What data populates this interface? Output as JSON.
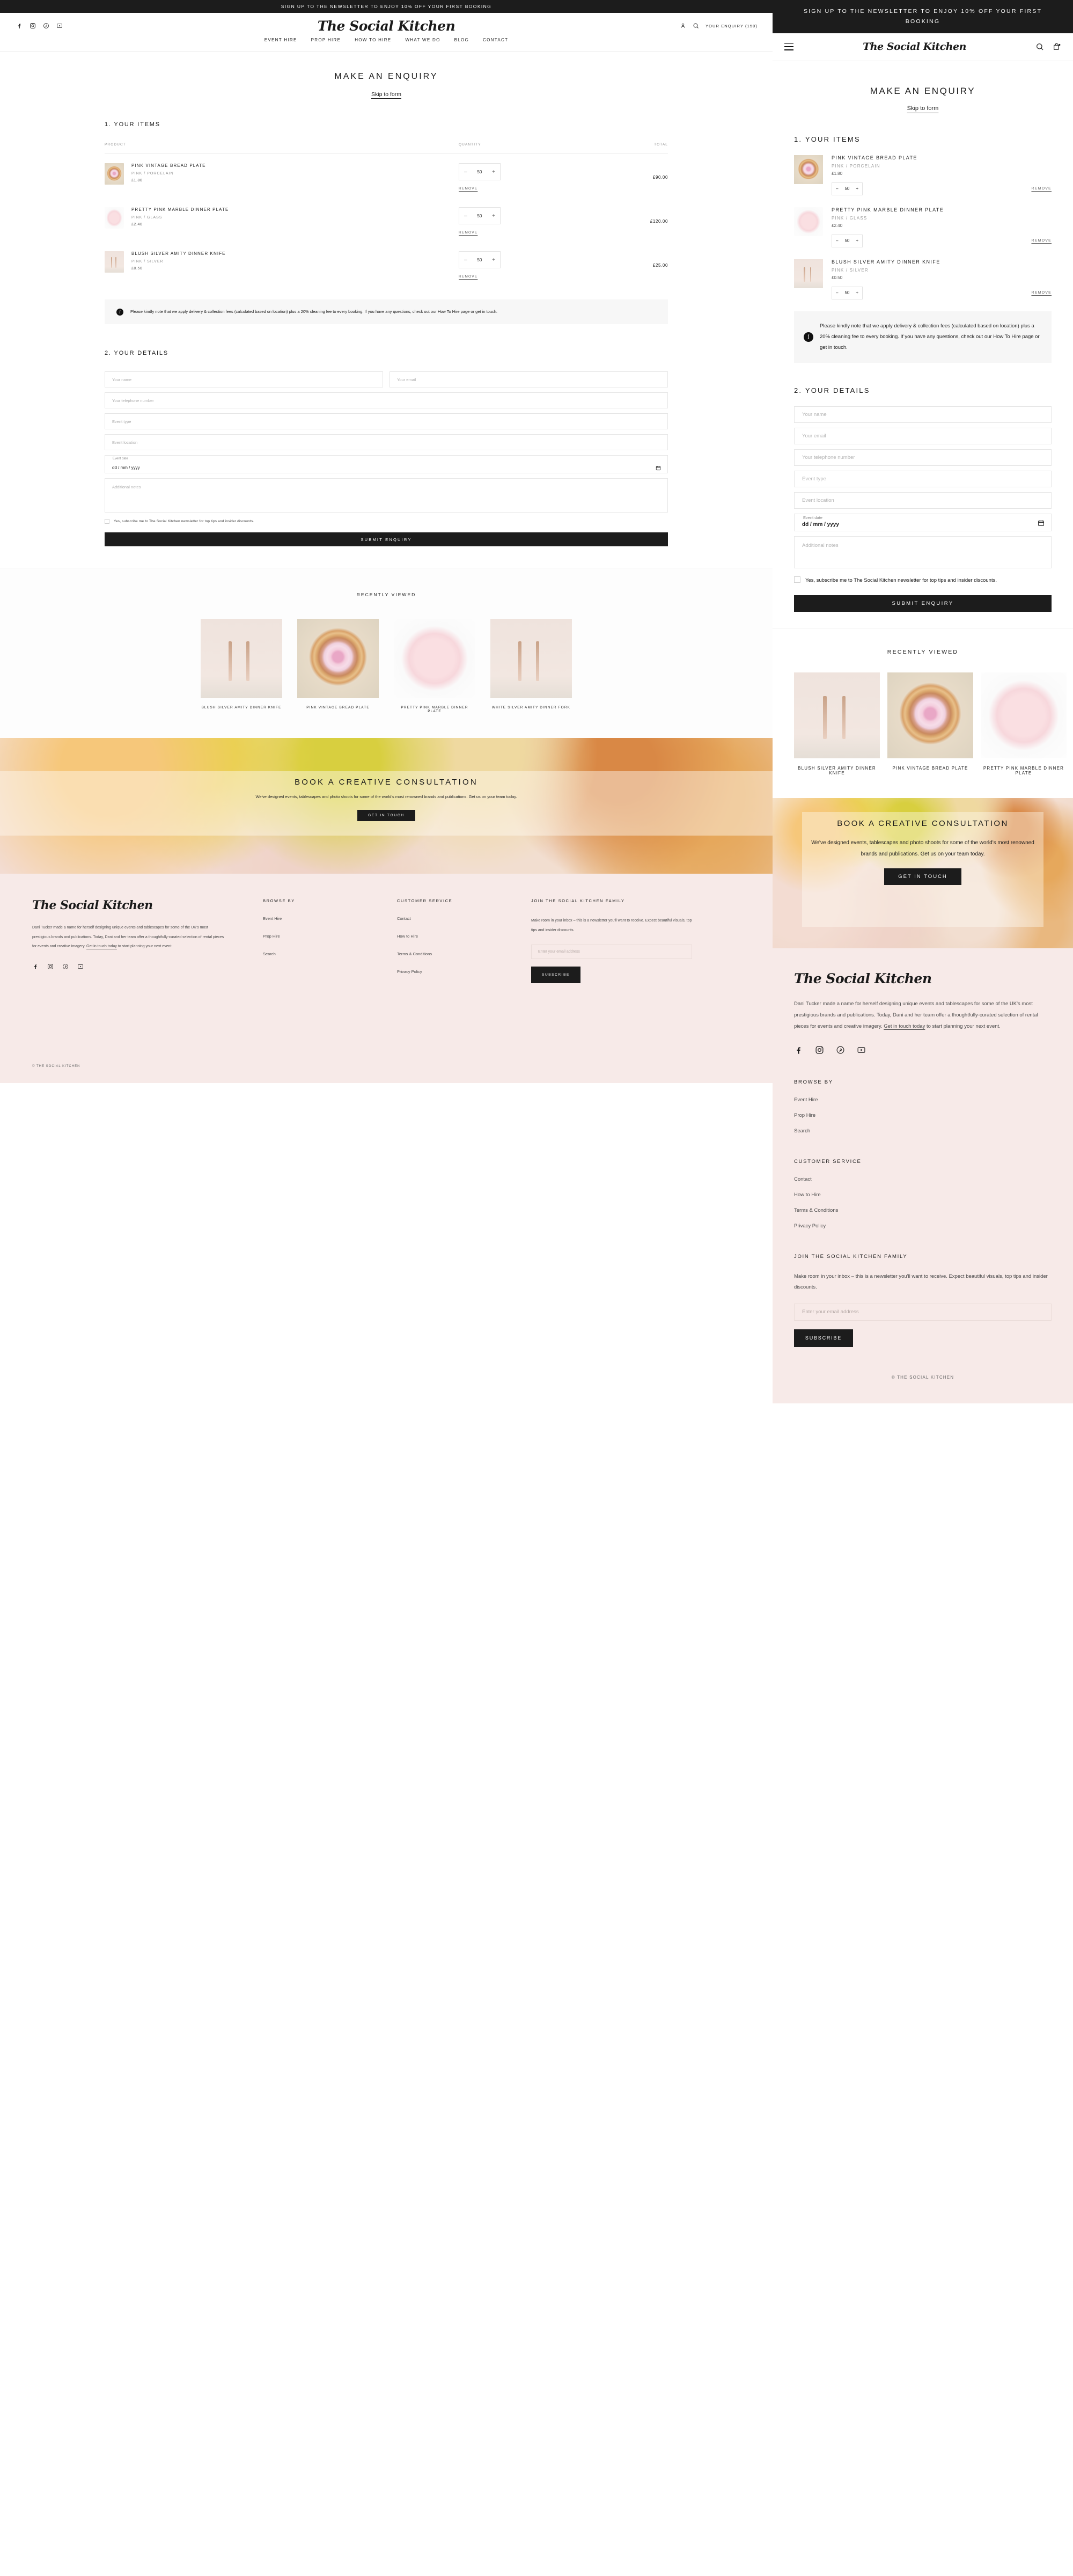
{
  "announcement": "SIGN UP TO THE NEWSLETTER TO ENJOY 10% OFF YOUR FIRST BOOKING",
  "brand": "The Social Kitchen",
  "header": {
    "enquiry_label": "YOUR ENQUIRY (150)",
    "nav": [
      "EVENT HIRE",
      "PROP HIRE",
      "HOW TO HIRE",
      "WHAT WE DO",
      "BLOG",
      "CONTACT"
    ],
    "social": [
      "facebook-icon",
      "instagram-icon",
      "pinterest-icon",
      "youtube-icon"
    ],
    "account_icon": "account-icon",
    "search_icon": "search-icon",
    "menu_icon": "hamburger-menu-icon",
    "bag_icon": "shopping-bag-icon"
  },
  "page": {
    "title": "MAKE AN ENQUIRY",
    "skip_link": "Skip to form"
  },
  "items_section": {
    "heading": "1. YOUR ITEMS",
    "columns": [
      "PRODUCT",
      "QUANTITY",
      "TOTAL"
    ],
    "remove_label": "REMOVE",
    "minus": "–",
    "plus": "+",
    "rows": [
      {
        "name": "PINK VINTAGE BREAD PLATE",
        "variant": "PINK / PORCELAIN",
        "price": "£1.80",
        "qty": "50",
        "total": "£90.00",
        "art": "art-vintage"
      },
      {
        "name": "PRETTY PINK MARBLE DINNER PLATE",
        "variant": "PINK / GLASS",
        "price": "£2.40",
        "qty": "50",
        "total": "£120.00",
        "art": "art-marble"
      },
      {
        "name": "BLUSH SILVER AMITY DINNER KNIFE",
        "variant": "PINK / SILVER",
        "price": "£0.50",
        "qty": "50",
        "total": "£25.00",
        "art": "art-knife"
      }
    ]
  },
  "notice": {
    "icon": "info-icon",
    "text": "Please kindly note that we apply delivery & collection fees (calculated based on location) plus a 20% cleaning fee to every booking. If you have any questions, check out our How To Hire page or get in touch."
  },
  "details_section": {
    "heading": "2. YOUR DETAILS",
    "fields": {
      "name": "Your name",
      "email": "Your email",
      "telephone": "Your telephone number",
      "event_type": "Event type",
      "event_location": "Event location",
      "event_date_label": "Event date",
      "event_date_value": "dd / mm / yyyy",
      "notes": "Additional notes"
    },
    "calendar_icon": "calendar-icon",
    "checkbox_label": "Yes, subscribe me to The Social Kitchen newsletter for top tips and insider discounts.",
    "submit_label": "SUBMIT ENQUIRY"
  },
  "recently_viewed": {
    "heading": "RECENTLY VIEWED",
    "cards": [
      {
        "name": "BLUSH SILVER AMITY DINNER KNIFE",
        "art": "art-knife"
      },
      {
        "name": "PINK VINTAGE BREAD PLATE",
        "art": "art-vintage"
      },
      {
        "name": "PRETTY PINK MARBLE DINNER PLATE",
        "art": "art-marble"
      },
      {
        "name": "WHITE SILVER AMITY DINNER FORK",
        "art": "art-knife"
      }
    ]
  },
  "banner": {
    "heading": "BOOK A CREATIVE CONSULTATION",
    "body": "We've designed events, tablescapes and photo shoots for some of the world's most renowned brands and publications. Get us on your team today.",
    "button": "GET IN TOUCH"
  },
  "footer": {
    "logo": "The Social Kitchen",
    "about_before": "Dani Tucker made a name for herself designing unique events and tablescapes for some of the UK's most prestigious brands and publications. Today, Dani and her team offer a thoughtfully-curated selection of rental pieces for events and creative imagery. ",
    "about_link": "Get in touch today",
    "about_after": " to start planning your next event.",
    "social": [
      "facebook-icon",
      "instagram-icon",
      "pinterest-icon",
      "youtube-icon"
    ],
    "browse_heading": "BROWSE BY",
    "browse_links": [
      "Event Hire",
      "Prop Hire",
      "Search"
    ],
    "service_heading": "CUSTOMER SERVICE",
    "service_links": [
      "Contact",
      "How to Hire",
      "Terms & Conditions",
      "Privacy Policy"
    ],
    "newsletter_heading": "JOIN THE SOCIAL KITCHEN FAMILY",
    "newsletter_body": "Make room in your inbox – this is a newsletter you'll want to receive. Expect beautiful visuals, top tips and insider discounts.",
    "email_placeholder": "Enter your email address",
    "subscribe_label": "SUBSCRIBE",
    "copyright": "© THE SOCIAL KITCHEN"
  },
  "colors": {
    "dark": "#1c1c1c",
    "footer_bg": "#f7eae8",
    "notice_bg": "#f6f6f6"
  }
}
